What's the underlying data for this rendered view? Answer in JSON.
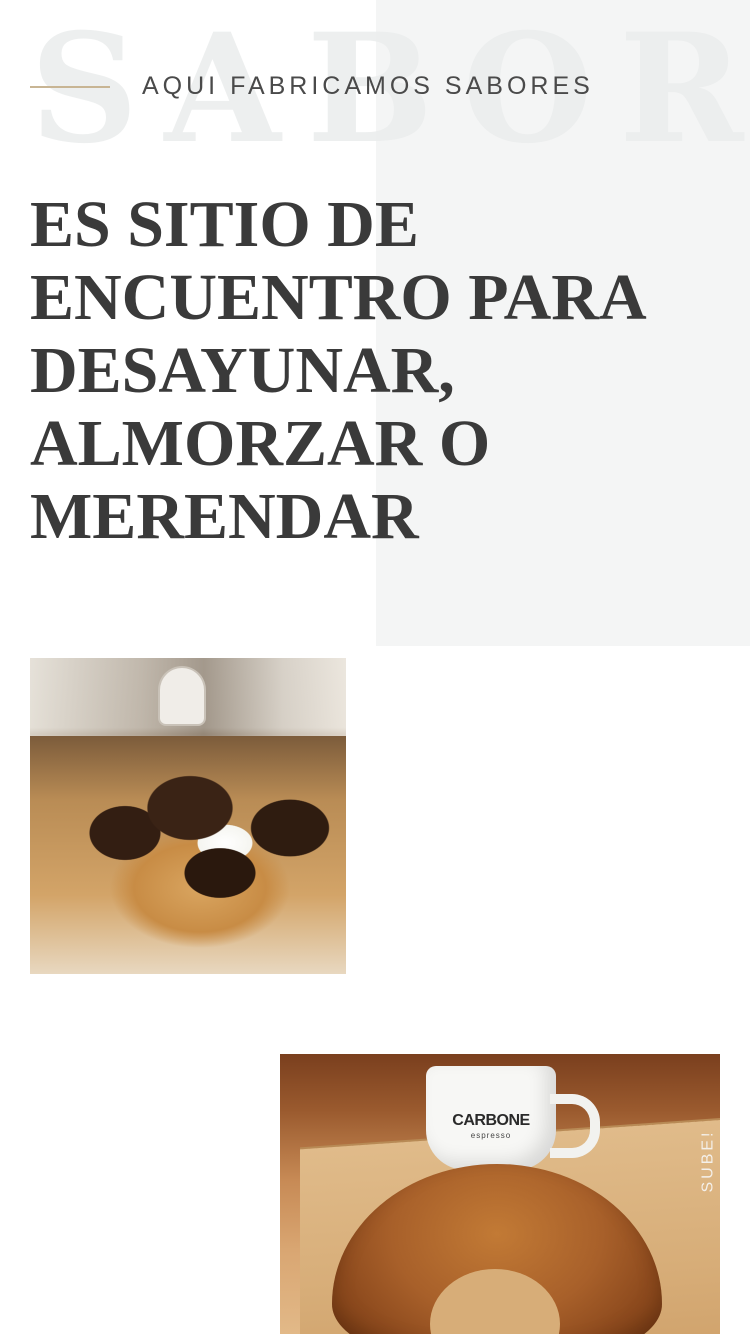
{
  "hero": {
    "watermark": "SABORES",
    "eyebrow": "AQUI FABRICAMOS SABORES",
    "headline": "ES SITIO DE ENCUENTRO PARA DESAYUNAR, ALMORZAR O MERENDAR"
  },
  "photos": {
    "croissant": {
      "cup_brand": "CARBONE",
      "cup_sub": "espresso"
    }
  },
  "scroll_top": {
    "label": "SUBE!"
  },
  "colors": {
    "accent_line": "#c8b594",
    "panel_bg": "#f4f5f5",
    "text_dark": "#3a3a3a"
  }
}
